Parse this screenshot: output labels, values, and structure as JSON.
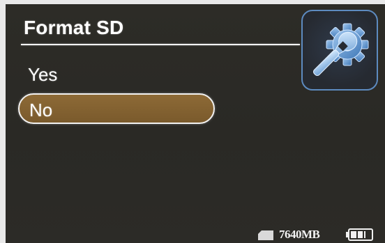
{
  "menu": {
    "title": "Format SD"
  },
  "options": [
    {
      "label": "Yes",
      "selected": false
    },
    {
      "label": "No",
      "selected": true
    }
  ],
  "status": {
    "capacity": "7640MB",
    "storage_icon": "sd-card-icon",
    "battery_icon": "battery-icon",
    "battery_level": 0.75
  },
  "icons": {
    "settings": "settings-gear-wrench-icon"
  },
  "colors": {
    "background": "#2b2a26",
    "selection_fill": "#83622f",
    "selection_border": "#f2f2f2",
    "badge_border": "#5d8bc0",
    "text": "#ffffff"
  }
}
